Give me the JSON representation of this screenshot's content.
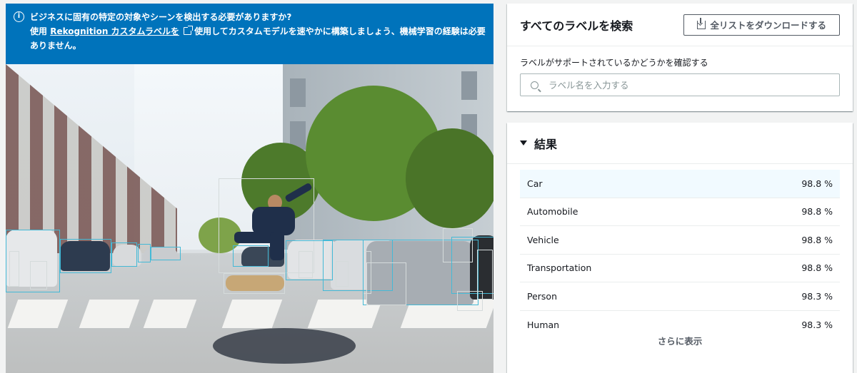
{
  "banner": {
    "line1": "ビジネスに固有の特定の対象やシーンを検出する必要がありますか?",
    "prefix": "使用",
    "link_text": "Rekognition カスタムラベルを",
    "suffix": "使用してカスタムモデルを速やかに構築しましょう、機械学習の経験は必要ありません。"
  },
  "search": {
    "title": "すべてのラベルを検索",
    "download_label": "全リストをダウンロードする",
    "field_label": "ラベルがサポートされているかどうかを確認する",
    "placeholder": "ラベル名を入力する"
  },
  "results": {
    "title": "結果",
    "rows": [
      {
        "label": "Car",
        "confidence": "98.8 %"
      },
      {
        "label": "Automobile",
        "confidence": "98.8 %"
      },
      {
        "label": "Vehicle",
        "confidence": "98.8 %"
      },
      {
        "label": "Transportation",
        "confidence": "98.8 %"
      },
      {
        "label": "Person",
        "confidence": "98.3 %"
      },
      {
        "label": "Human",
        "confidence": "98.3 %"
      }
    ],
    "show_more": "さらに表示"
  },
  "colors": {
    "banner": "#0073bb",
    "highlight_row": "#f1faff",
    "box_blue": "#44b9d6",
    "box_grey": "#d5dbdb"
  }
}
